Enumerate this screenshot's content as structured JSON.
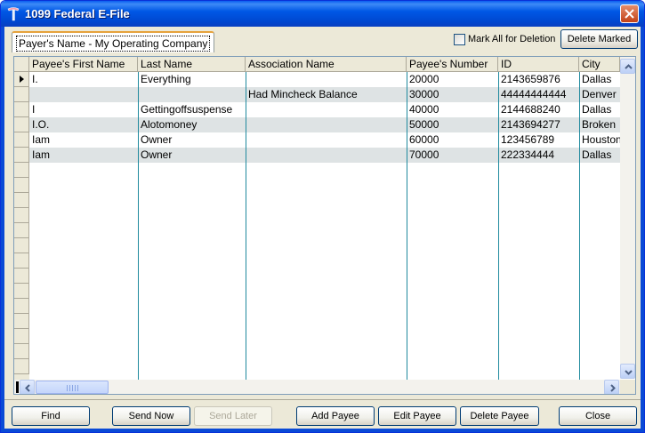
{
  "window": {
    "title": "1099 Federal E-File"
  },
  "payer_tab": {
    "label": "Payer's Name - My Operating Company"
  },
  "mark_all": {
    "label": "Mark All for Deletion",
    "checked": false
  },
  "top_buttons": {
    "delete_marked": "Delete Marked"
  },
  "grid": {
    "columns": [
      "Payee's First Name",
      "Last Name",
      "Association Name",
      "Payee's Number",
      "ID",
      "City"
    ],
    "rows": [
      {
        "first": "I.",
        "last": "Everything",
        "association": "",
        "number": "20000",
        "id": "2143659876",
        "city": "Dallas"
      },
      {
        "first": "",
        "last": "",
        "association": "Had Mincheck Balance",
        "number": "30000",
        "id": "44444444444",
        "city": "Denver"
      },
      {
        "first": "I",
        "last": "Gettingoffsuspense",
        "association": "",
        "number": "40000",
        "id": "2144688240",
        "city": "Dallas"
      },
      {
        "first": "I.O.",
        "last": "Alotomoney",
        "association": "",
        "number": "50000",
        "id": "2143694277",
        "city": "Broken"
      },
      {
        "first": "Iam",
        "last": "Owner",
        "association": "",
        "number": "60000",
        "id": "123456789",
        "city": "Houston"
      },
      {
        "first": "Iam",
        "last": "Owner",
        "association": "",
        "number": "70000",
        "id": "222334444",
        "city": "Dallas"
      }
    ]
  },
  "buttons": {
    "find": "Find",
    "send_now": "Send Now",
    "send_later": "Send Later",
    "add_payee": "Add Payee",
    "edit_payee": "Edit Payee",
    "delete_payee": "Delete Payee",
    "close": "Close"
  },
  "colors": {
    "title_bar": "#0058e6",
    "grid_lines": "#208a9e",
    "alt_row": "#dee3e4"
  }
}
